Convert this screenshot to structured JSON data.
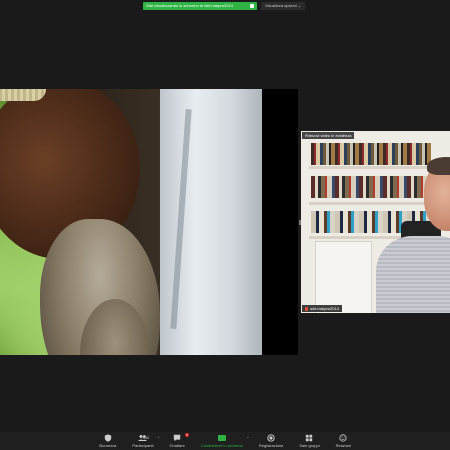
{
  "banner": {
    "share_text": "Stai visualizzando lo schermo di wkf-marpro2014",
    "view_options": "Visualizza opzioni"
  },
  "participant": {
    "spotlight_label": "Rimuovi video in evidenza",
    "name": "wkf-marpro2014"
  },
  "toolbar": {
    "security": "Sicurezza",
    "participants": "Partecipanti",
    "participants_count": "340",
    "chat": "Chattare",
    "chat_badge": "5",
    "share": "Condividere lo schermo",
    "record": "Registrazione",
    "breakout": "Sale gruppi",
    "reactions": "Reazioni"
  }
}
